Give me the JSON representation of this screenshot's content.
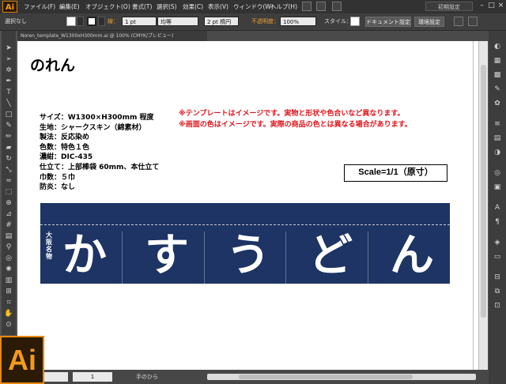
{
  "app": {
    "logo": "Ai",
    "badge": "Ai"
  },
  "menu": {
    "items": [
      "ファイル(F)",
      "編集(E)",
      "オブジェクト(O)",
      "書式(T)",
      "選択(S)",
      "効果(C)",
      "表示(V)",
      "ウィンドウ(W)",
      "ヘルプ(H)"
    ],
    "workspace": "初期設定"
  },
  "control": {
    "selection_status": "選択なし",
    "stroke_label": "線：",
    "stroke_weight": "1 pt",
    "stroke_style": "均等",
    "brush": "2 pt 楕円",
    "opacity_label": "不透明度：",
    "opacity_value": "100%",
    "style_label": "スタイル：",
    "doc_setup": "ドキュメント設定",
    "preferences": "環境設定",
    "accent_color": "#e8890f"
  },
  "document": {
    "tab": "Noren_template_W1300xH300mm.ai @ 100% (CMYK/プレビュー)",
    "title": "のれん",
    "specs": [
      "サイズ：W1300×H300mm 程度",
      "生地：シャークスキン（綿素材）",
      "製法：反応染め",
      "色数：特色１色",
      "濃紺：DIC-435",
      "仕立て：上部棒袋 60mm、本仕立て",
      "巾数：５巾",
      "防炎：なし"
    ],
    "notes": [
      "※テンプレートはイメージです。実物と形状や色合いなど異なります。",
      "※画面の色はイメージです。実際の商品の色とは異なる場合があります。"
    ],
    "scale": "Scale=1/1（原寸）",
    "noren": {
      "subtitle": "大阪名物",
      "glyphs": [
        "か",
        "す",
        "う",
        "ど",
        "ん"
      ],
      "color": "#1d3464"
    }
  },
  "status": {
    "zoom": "100%",
    "page": "1",
    "tool": "手のひら"
  },
  "icons": [
    "selection-tool-icon",
    "direct-selection-tool-icon",
    "magic-wand-icon",
    "lasso-icon",
    "pen-tool-icon",
    "type-tool-icon",
    "line-tool-icon",
    "rectangle-tool-icon",
    "paintbrush-icon",
    "pencil-icon",
    "eraser-icon",
    "rotate-icon",
    "scale-icon",
    "warp-icon",
    "free-transform-icon",
    "shape-builder-icon",
    "perspective-icon",
    "mesh-icon",
    "gradient-icon",
    "eyedropper-icon",
    "blend-icon",
    "symbol-sprayer-icon",
    "graph-icon",
    "artboard-icon",
    "slice-icon",
    "hand-tool-icon",
    "zoom-tool-icon"
  ]
}
